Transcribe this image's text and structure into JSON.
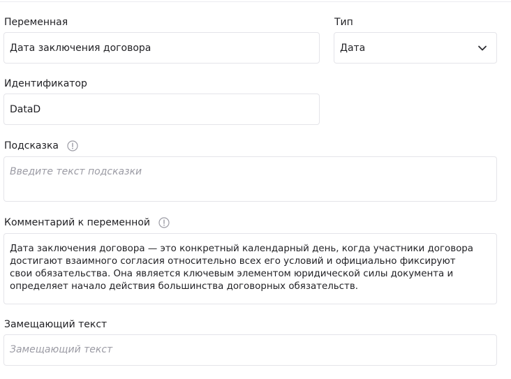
{
  "form": {
    "variable": {
      "label": "Переменная",
      "value": "Дата заключения договора"
    },
    "type": {
      "label": "Тип",
      "selected": "Дата",
      "icon": "chevron-down-icon"
    },
    "identifier": {
      "label": "Идентификатор",
      "value": "DataD"
    },
    "hint": {
      "label": "Подсказка",
      "icon": "info-icon",
      "placeholder": "Введите текст подсказки"
    },
    "comment": {
      "label": "Комментарий к переменной",
      "icon": "info-icon",
      "value": "Дата заключения договора — это конкретный календарный день, когда участники договора\nдостигают взаимного согласия относительно всех его условий и официально фиксируют\nсвои обязательства. Она является ключевым элементом юридической силы документа и\nопределяет начало действия большинства договорных обязательств."
    },
    "replacement_text": {
      "label": "Замещающий текст",
      "placeholder": "Замещающий текст"
    }
  },
  "colors": {
    "border": "#e4e4e9",
    "text": "#1f1f23",
    "placeholder": "#9b9ba4"
  }
}
